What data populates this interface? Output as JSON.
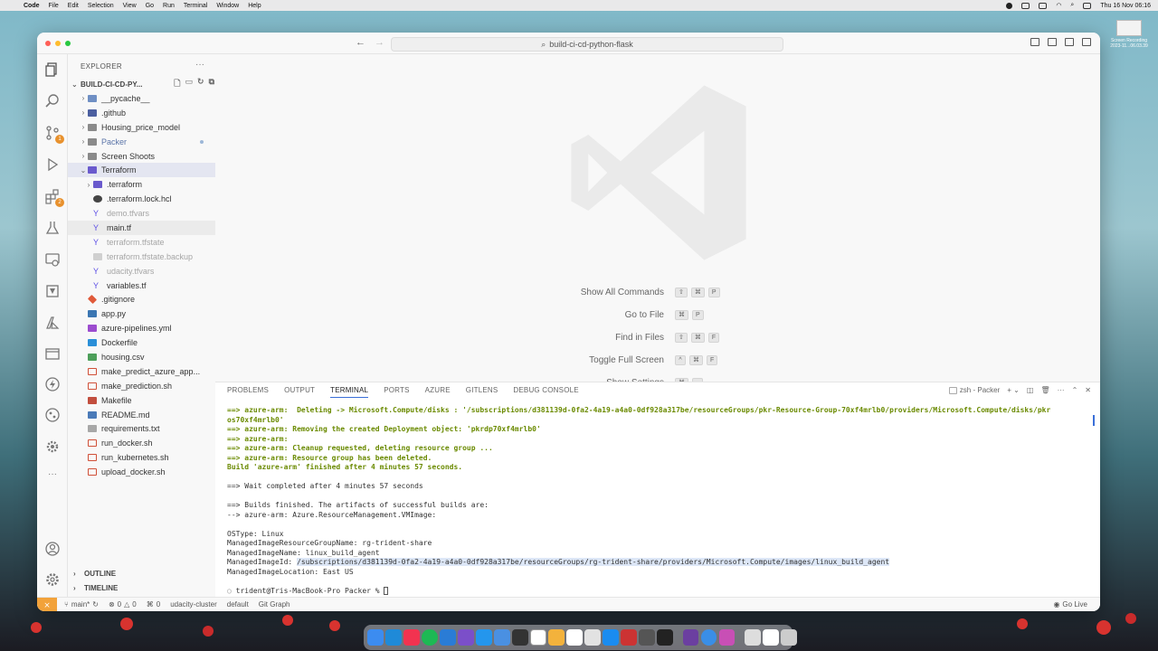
{
  "menubar": {
    "app": "Code",
    "items": [
      "File",
      "Edit",
      "Selection",
      "View",
      "Go",
      "Run",
      "Terminal",
      "Window",
      "Help"
    ],
    "datetime": "Thu 16 Nov  06:16"
  },
  "desktop": {
    "icon_label_1": "Screen Recording",
    "icon_label_2": "2023-11...06.03.39"
  },
  "window": {
    "search": "build-ci-cd-python-flask"
  },
  "sidebar": {
    "title": "EXPLORER",
    "root": "BUILD-CI-CD-PY...",
    "outline": "OUTLINE",
    "timeline": "TIMELINE",
    "items": [
      {
        "label": "__pycache__"
      },
      {
        "label": ".github"
      },
      {
        "label": "Housing_price_model"
      },
      {
        "label": "Packer"
      },
      {
        "label": "Screen Shoots"
      },
      {
        "label": "Terraform"
      },
      {
        "label": ".terraform"
      },
      {
        "label": ".terraform.lock.hcl"
      },
      {
        "label": "demo.tfvars"
      },
      {
        "label": "main.tf"
      },
      {
        "label": "terraform.tfstate"
      },
      {
        "label": "terraform.tfstate.backup"
      },
      {
        "label": "udacity.tfvars"
      },
      {
        "label": "variables.tf"
      },
      {
        "label": ".gitignore"
      },
      {
        "label": "app.py"
      },
      {
        "label": "azure-pipelines.yml"
      },
      {
        "label": "Dockerfile"
      },
      {
        "label": "housing.csv"
      },
      {
        "label": "make_predict_azure_app..."
      },
      {
        "label": "make_prediction.sh"
      },
      {
        "label": "Makefile"
      },
      {
        "label": "README.md"
      },
      {
        "label": "requirements.txt"
      },
      {
        "label": "run_docker.sh"
      },
      {
        "label": "run_kubernetes.sh"
      },
      {
        "label": "upload_docker.sh"
      }
    ]
  },
  "editor": {
    "commands": [
      {
        "label": "Show All Commands",
        "keys": [
          "⇧",
          "⌘",
          "P"
        ]
      },
      {
        "label": "Go to File",
        "keys": [
          "⌘",
          "P"
        ]
      },
      {
        "label": "Find in Files",
        "keys": [
          "⇧",
          "⌘",
          "F"
        ]
      },
      {
        "label": "Toggle Full Screen",
        "keys": [
          "^",
          "⌘",
          "F"
        ]
      },
      {
        "label": "Show Settings",
        "keys": [
          "⌘",
          ","
        ]
      }
    ]
  },
  "panel": {
    "tabs": [
      "PROBLEMS",
      "OUTPUT",
      "TERMINAL",
      "PORTS",
      "AZURE",
      "GITLENS",
      "DEBUG CONSOLE"
    ],
    "shell": "zsh - Packer",
    "terminal": [
      "==> azure-arm:  Deleting -> Microsoft.Compute/disks : '/subscriptions/d381139d-0fa2-4a19-a4a0-0df928a317be/resourceGroups/pkr-Resource-Group-70xf4mrlb0/providers/Microsoft.Compute/disks/pkr",
      "os70xf4mrlb0'",
      "==> azure-arm: Removing the created Deployment object: 'pkrdp70xf4mrlb0'",
      "==> azure-arm:",
      "==> azure-arm: Cleanup requested, deleting resource group ...",
      "==> azure-arm: Resource group has been deleted.",
      "Build 'azure-arm' finished after 4 minutes 57 seconds.",
      "",
      "==> Wait completed after 4 minutes 57 seconds",
      "",
      "==> Builds finished. The artifacts of successful builds are:",
      "--> azure-arm: Azure.ResourceManagement.VMImage:",
      "",
      "OSType: Linux",
      "ManagedImageResourceGroupName: rg-trident-share",
      "ManagedImageName: linux_build_agent",
      "ManagedImageId: /subscriptions/d381139d-0fa2-4a19-a4a0-0df928a317be/resourceGroups/rg-trident-share/providers/Microsoft.Compute/images/linux_build_agent",
      "ManagedImageLocation: East US",
      "",
      "trident@Tris-MacBook-Pro Packer % "
    ]
  },
  "statusbar": {
    "branch": "main*",
    "errors": "0",
    "warnings": "0",
    "ports": "0",
    "cluster": "udacity-cluster",
    "namespace": "default",
    "git_graph": "Git Graph",
    "go_live": "Go Live"
  },
  "colors": {
    "accent": "#3a6fd8",
    "terminal_green": "#6a8a00",
    "remote": "#f2a23a",
    "terraform": "#5c4ee5"
  }
}
